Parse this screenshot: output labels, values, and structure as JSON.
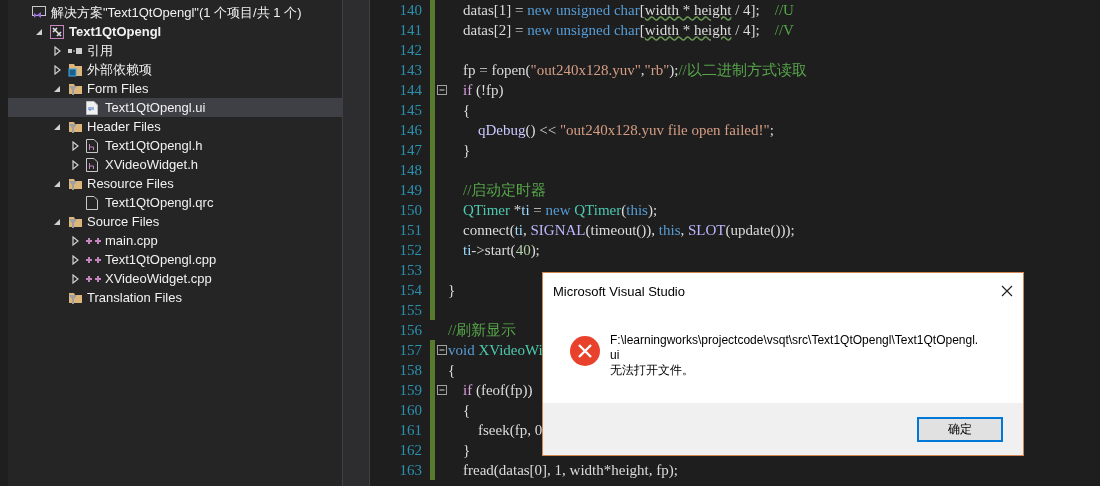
{
  "solution_explorer": {
    "items": [
      {
        "label": "解决方案\"Text1QtOpengl\"(1 个项目/共 1 个)",
        "kind": "solution",
        "selected": false,
        "children": [
          {
            "label": "Text1QtOpengl",
            "kind": "project",
            "expanded": true,
            "selected": false,
            "children": [
              {
                "label": "引用",
                "kind": "references",
                "expanded": false,
                "selected": false
              },
              {
                "label": "外部依赖项",
                "kind": "external",
                "expanded": false,
                "selected": false
              },
              {
                "label": "Form Files",
                "kind": "filter",
                "expanded": true,
                "selected": false,
                "children": [
                  {
                    "label": "Text1QtOpengl.ui",
                    "kind": "ui",
                    "selected": true
                  }
                ]
              },
              {
                "label": "Header Files",
                "kind": "filter",
                "expanded": true,
                "selected": false,
                "children": [
                  {
                    "label": "Text1QtOpengl.h",
                    "kind": "header",
                    "expanded": false,
                    "selected": false
                  },
                  {
                    "label": "XVideoWidget.h",
                    "kind": "header",
                    "expanded": false,
                    "selected": false
                  }
                ]
              },
              {
                "label": "Resource Files",
                "kind": "filter",
                "expanded": true,
                "selected": false,
                "children": [
                  {
                    "label": "Text1QtOpengl.qrc",
                    "kind": "file",
                    "selected": false
                  }
                ]
              },
              {
                "label": "Source Files",
                "kind": "filter",
                "expanded": true,
                "selected": false,
                "children": [
                  {
                    "label": "main.cpp",
                    "kind": "cpp",
                    "expanded": false,
                    "selected": false
                  },
                  {
                    "label": "Text1QtOpengl.cpp",
                    "kind": "cpp",
                    "expanded": false,
                    "selected": false
                  },
                  {
                    "label": "XVideoWidget.cpp",
                    "kind": "cpp",
                    "expanded": false,
                    "selected": false
                  }
                ]
              },
              {
                "label": "Translation Files",
                "kind": "filter",
                "selected": false
              }
            ]
          }
        ]
      }
    ]
  },
  "editor": {
    "lines": [
      {
        "number": "140",
        "changed": true,
        "fold": false,
        "tokens": [
          {
            "kind": "plain",
            "t": "    datas[1] = "
          },
          {
            "kind": "kw",
            "t": "new unsigned char"
          },
          {
            "kind": "plain",
            "t": "["
          },
          {
            "kind": "squiggle",
            "t": "width * height"
          },
          {
            "kind": "plain",
            "t": " / 4];"
          },
          {
            "kind": "comment",
            "t": "    //U"
          }
        ]
      },
      {
        "number": "141",
        "changed": true,
        "fold": false,
        "tokens": [
          {
            "kind": "plain",
            "t": "    datas[2] = "
          },
          {
            "kind": "kw",
            "t": "new unsigned char"
          },
          {
            "kind": "plain",
            "t": "["
          },
          {
            "kind": "squiggle",
            "t": "width * height"
          },
          {
            "kind": "plain",
            "t": " / 4];"
          },
          {
            "kind": "comment",
            "t": "    //V"
          }
        ]
      },
      {
        "number": "142",
        "changed": true,
        "fold": false
      },
      {
        "number": "143",
        "changed": true,
        "fold": false,
        "tokens": [
          {
            "kind": "plain",
            "t": "    fp = fopen("
          },
          {
            "kind": "str",
            "t": "\"out240x128.yuv\""
          },
          {
            "kind": "plain",
            "t": ","
          },
          {
            "kind": "str",
            "t": "\"rb\""
          },
          {
            "kind": "plain",
            "t": ");"
          },
          {
            "kind": "comment",
            "t": "//以二进制方式读取"
          }
        ]
      },
      {
        "number": "144",
        "changed": true,
        "fold": true,
        "tokens": [
          {
            "kind": "ctrl",
            "t": "    if"
          },
          {
            "kind": "plain",
            "t": " (!fp)"
          }
        ]
      },
      {
        "number": "145",
        "changed": true,
        "fold": false,
        "tokens": [
          {
            "kind": "plain",
            "t": "    {"
          }
        ]
      },
      {
        "number": "146",
        "changed": true,
        "fold": false,
        "tokens": [
          {
            "kind": "func",
            "t": "        qDebug"
          },
          {
            "kind": "plain",
            "t": "() << "
          },
          {
            "kind": "str",
            "t": "\"out240x128.yuv file open failed!\""
          },
          {
            "kind": "plain",
            "t": ";"
          }
        ]
      },
      {
        "number": "147",
        "changed": true,
        "fold": false,
        "tokens": [
          {
            "kind": "plain",
            "t": "    }"
          }
        ]
      },
      {
        "number": "148",
        "changed": true,
        "fold": false
      },
      {
        "number": "149",
        "changed": true,
        "fold": false,
        "tokens": [
          {
            "kind": "comment",
            "t": "    //启动定时器"
          }
        ]
      },
      {
        "number": "150",
        "changed": true,
        "fold": false,
        "tokens": [
          {
            "kind": "type",
            "t": "    QTimer"
          },
          {
            "kind": "plain",
            "t": " *"
          },
          {
            "kind": "var",
            "t": "ti"
          },
          {
            "kind": "plain",
            "t": " = "
          },
          {
            "kind": "kw",
            "t": "new "
          },
          {
            "kind": "type",
            "t": "QTimer"
          },
          {
            "kind": "plain",
            "t": "("
          },
          {
            "kind": "kw",
            "t": "this"
          },
          {
            "kind": "plain",
            "t": ");"
          }
        ]
      },
      {
        "number": "151",
        "changed": true,
        "fold": false,
        "tokens": [
          {
            "kind": "plain",
            "t": "    connect("
          },
          {
            "kind": "var",
            "t": "ti"
          },
          {
            "kind": "plain",
            "t": ", "
          },
          {
            "kind": "macro",
            "t": "SIGNAL"
          },
          {
            "kind": "plain",
            "t": "(timeout()), "
          },
          {
            "kind": "kw",
            "t": "this"
          },
          {
            "kind": "plain",
            "t": ", "
          },
          {
            "kind": "macro",
            "t": "SLOT"
          },
          {
            "kind": "plain",
            "t": "(update()));"
          }
        ]
      },
      {
        "number": "152",
        "changed": true,
        "fold": false,
        "tokens": [
          {
            "kind": "var",
            "t": "    ti"
          },
          {
            "kind": "plain",
            "t": "->start("
          },
          {
            "kind": "num",
            "t": "40"
          },
          {
            "kind": "plain",
            "t": ");"
          }
        ]
      },
      {
        "number": "153",
        "changed": true,
        "fold": false
      },
      {
        "number": "154",
        "changed": true,
        "fold": false,
        "tokens": [
          {
            "kind": "plain",
            "t": "}"
          }
        ]
      },
      {
        "number": "155",
        "changed": true,
        "fold": false
      },
      {
        "number": "156",
        "changed": false,
        "fold": false,
        "tokens": [
          {
            "kind": "comment",
            "t": "//刷新显示"
          }
        ]
      },
      {
        "number": "157",
        "changed": true,
        "fold": true,
        "tokens": [
          {
            "kind": "kw",
            "t": "void "
          },
          {
            "kind": "type",
            "t": "XVideoWi"
          }
        ]
      },
      {
        "number": "158",
        "changed": true,
        "fold": false,
        "tokens": [
          {
            "kind": "plain",
            "t": "{"
          }
        ]
      },
      {
        "number": "159",
        "changed": true,
        "fold": true,
        "tokens": [
          {
            "kind": "ctrl",
            "t": "    if"
          },
          {
            "kind": "plain",
            "t": " (feof(fp))"
          }
        ]
      },
      {
        "number": "160",
        "changed": true,
        "fold": false,
        "tokens": [
          {
            "kind": "plain",
            "t": "    {"
          }
        ]
      },
      {
        "number": "161",
        "changed": true,
        "fold": false,
        "tokens": [
          {
            "kind": "plain",
            "t": "        fseek(fp, 0"
          }
        ]
      },
      {
        "number": "162",
        "changed": true,
        "fold": false,
        "tokens": [
          {
            "kind": "plain",
            "t": "    }"
          }
        ]
      },
      {
        "number": "163",
        "changed": true,
        "fold": false,
        "tokens": [
          {
            "kind": "plain",
            "t": "    fread(datas[0], 1, width*height, fp);"
          }
        ]
      }
    ]
  },
  "dialog": {
    "title": "Microsoft Visual Studio",
    "path_lines": [
      "F:\\learningworks\\projectcode\\vsqt\\src\\Text1QtOpengl\\Text1QtOpengl.",
      "ui"
    ],
    "message": "无法打开文件。",
    "buttons": [
      {
        "label": "确定",
        "selected": true
      }
    ]
  }
}
